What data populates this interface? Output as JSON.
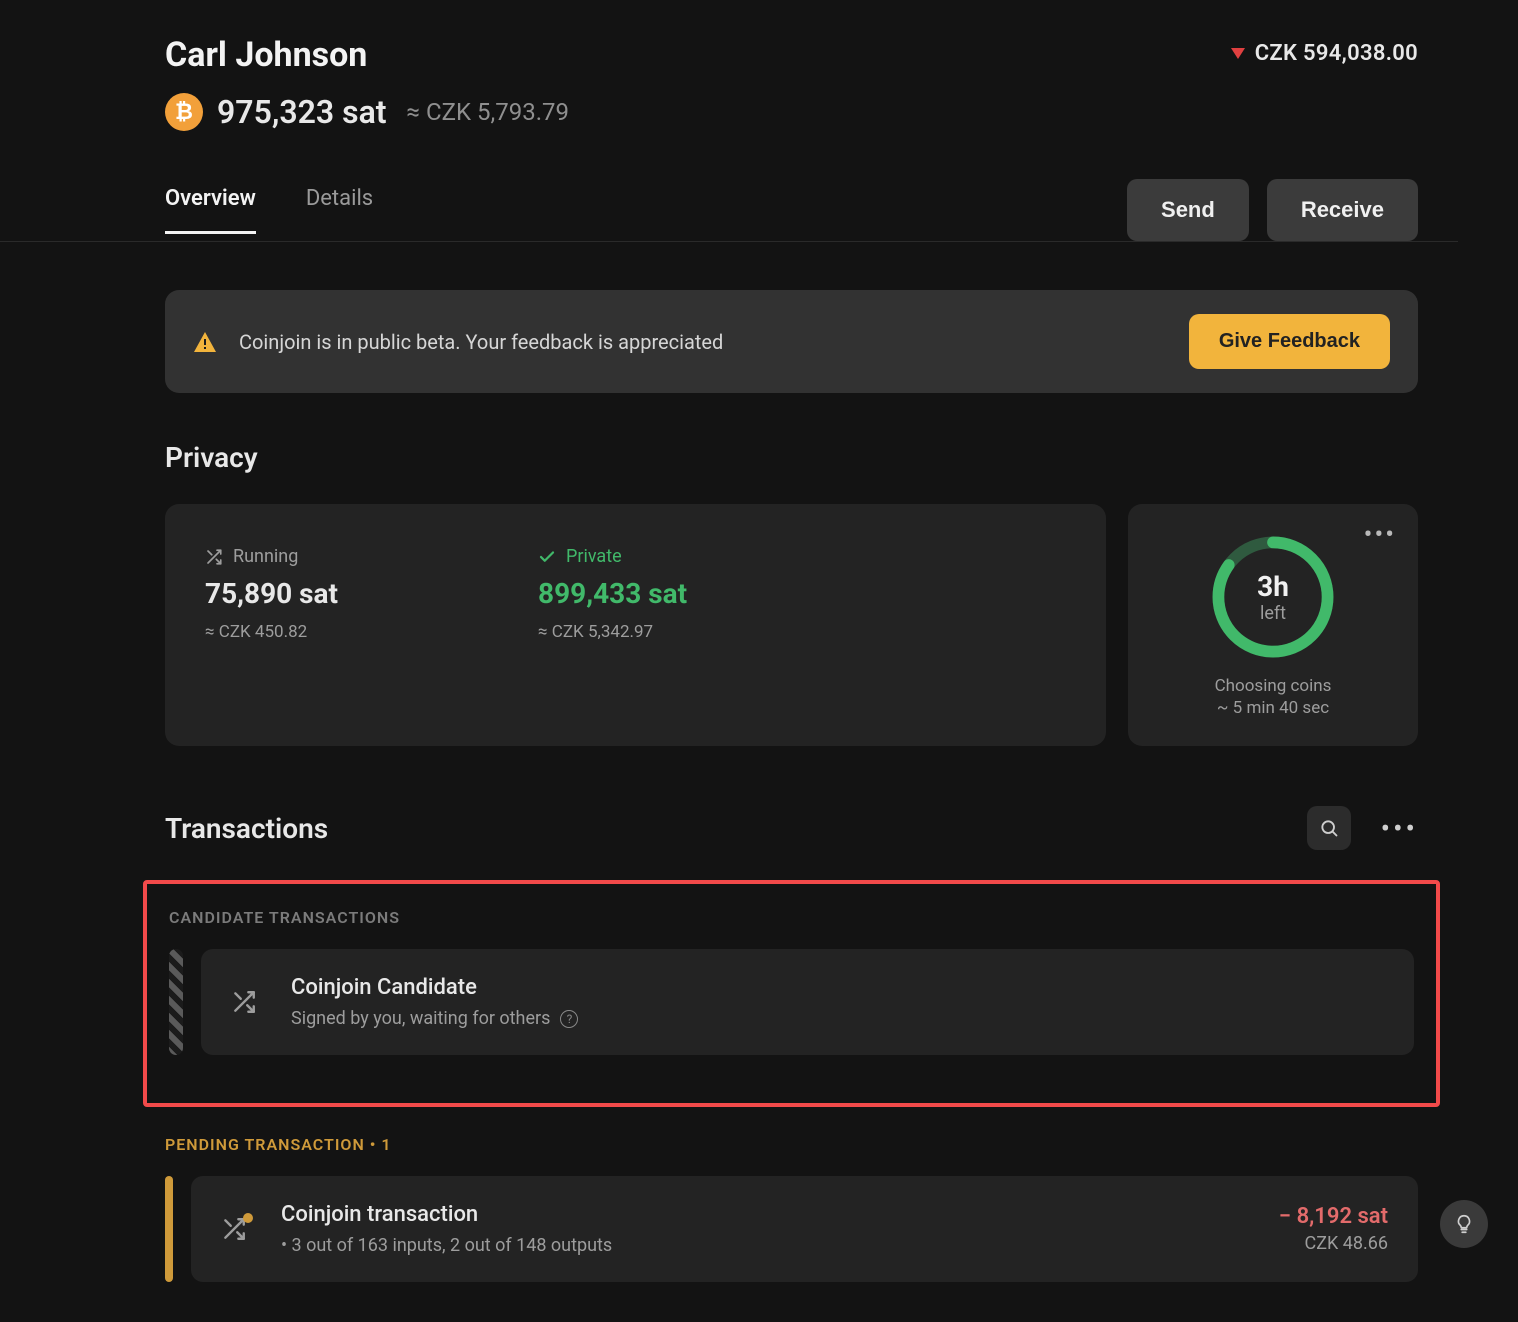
{
  "header": {
    "account_name": "Carl Johnson",
    "balance_sat": "975,323 sat",
    "balance_approx": "≈ CZK 5,793.79",
    "fiat_total": "CZK 594,038.00",
    "tabs": {
      "overview": "Overview",
      "details": "Details"
    },
    "buttons": {
      "send": "Send",
      "receive": "Receive"
    }
  },
  "banner": {
    "text": "Coinjoin is in public beta. Your feedback is appreciated",
    "cta": "Give Feedback"
  },
  "privacy": {
    "title": "Privacy",
    "running": {
      "label": "Running",
      "amount": "75,890 sat",
      "fiat": "≈ CZK 450.82"
    },
    "private": {
      "label": "Private",
      "amount": "899,433 sat",
      "fiat": "≈ CZK 5,342.97"
    },
    "countdown": {
      "value": "3h",
      "left": "left",
      "line1": "Choosing coins",
      "line2": "~ 5 min 40 sec"
    }
  },
  "transactions": {
    "title": "Transactions",
    "candidate_label": "CANDIDATE TRANSACTIONS",
    "candidate": {
      "title": "Coinjoin Candidate",
      "subtitle": "Signed by you, waiting for others"
    },
    "pending_label": "PENDING TRANSACTION • 1",
    "pending": {
      "title": "Coinjoin transaction",
      "subtitle": "•   3 out of 163 inputs, 2 out of 148 outputs",
      "amount": "− 8,192 sat",
      "fiat": "CZK 48.66"
    }
  }
}
